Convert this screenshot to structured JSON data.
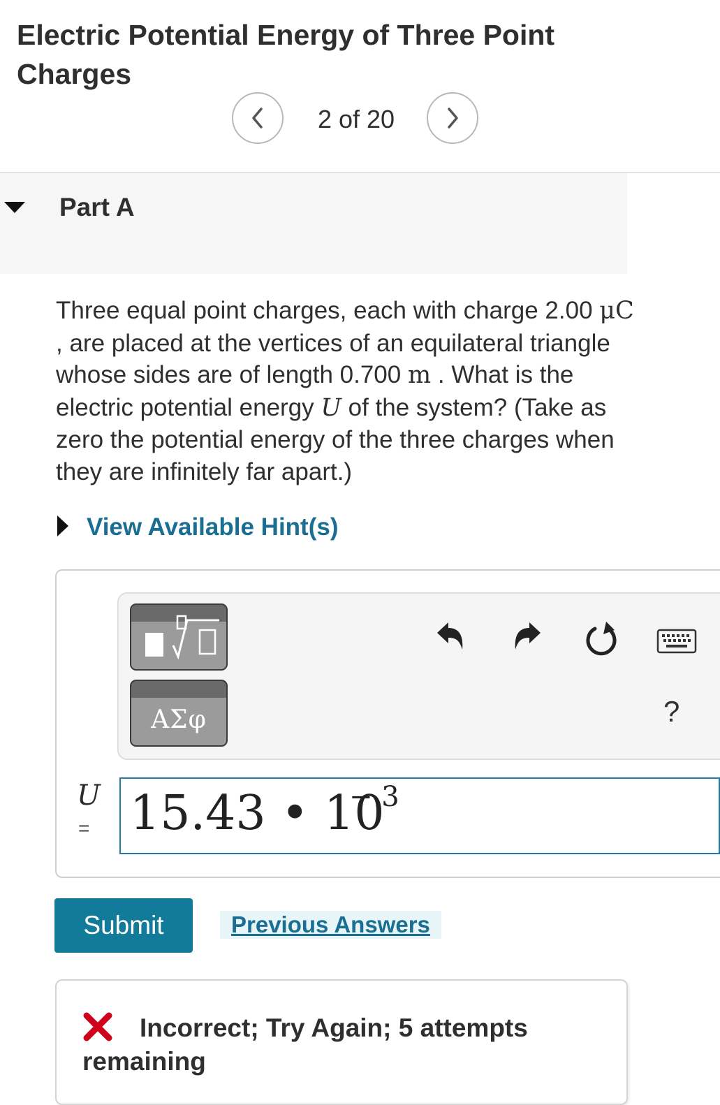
{
  "header": {
    "title": "Electric Potential Energy of Three Point Charges",
    "page_count": "2 of 20"
  },
  "part": {
    "label": "Part A"
  },
  "question": {
    "seg1": "Three equal point charges, each with charge 2.00 ",
    "unit_charge": "μC",
    "seg2": " , are placed at the vertices of an equilateral triangle whose sides are of length 0.700 ",
    "unit_length": "m",
    "seg3": " . What is the electric potential energy ",
    "symbol": "U",
    "seg4": " of the system? (Take as zero the potential energy of the three charges when they are infinitely far apart.)"
  },
  "hint": {
    "label": "View Available Hint(s)"
  },
  "toolbar": {
    "greek_label": "ΑΣφ",
    "help_label": "?",
    "icons": [
      "templates-icon",
      "greek-letters-icon",
      "undo-icon",
      "redo-icon",
      "reset-icon",
      "keyboard-icon",
      "help-icon"
    ]
  },
  "answer": {
    "variable": "U",
    "equals": "=",
    "mantissa": "15.43 • 10",
    "exponent": "− 3"
  },
  "actions": {
    "submit_label": "Submit",
    "previous_answers_label": "Previous Answers"
  },
  "feedback": {
    "message": "Incorrect; Try Again; 5 attempts remaining",
    "status_color": "#d0021b"
  },
  "colors": {
    "accent": "#137b9a",
    "link": "#1a6e91",
    "input_border": "#257aa0"
  }
}
